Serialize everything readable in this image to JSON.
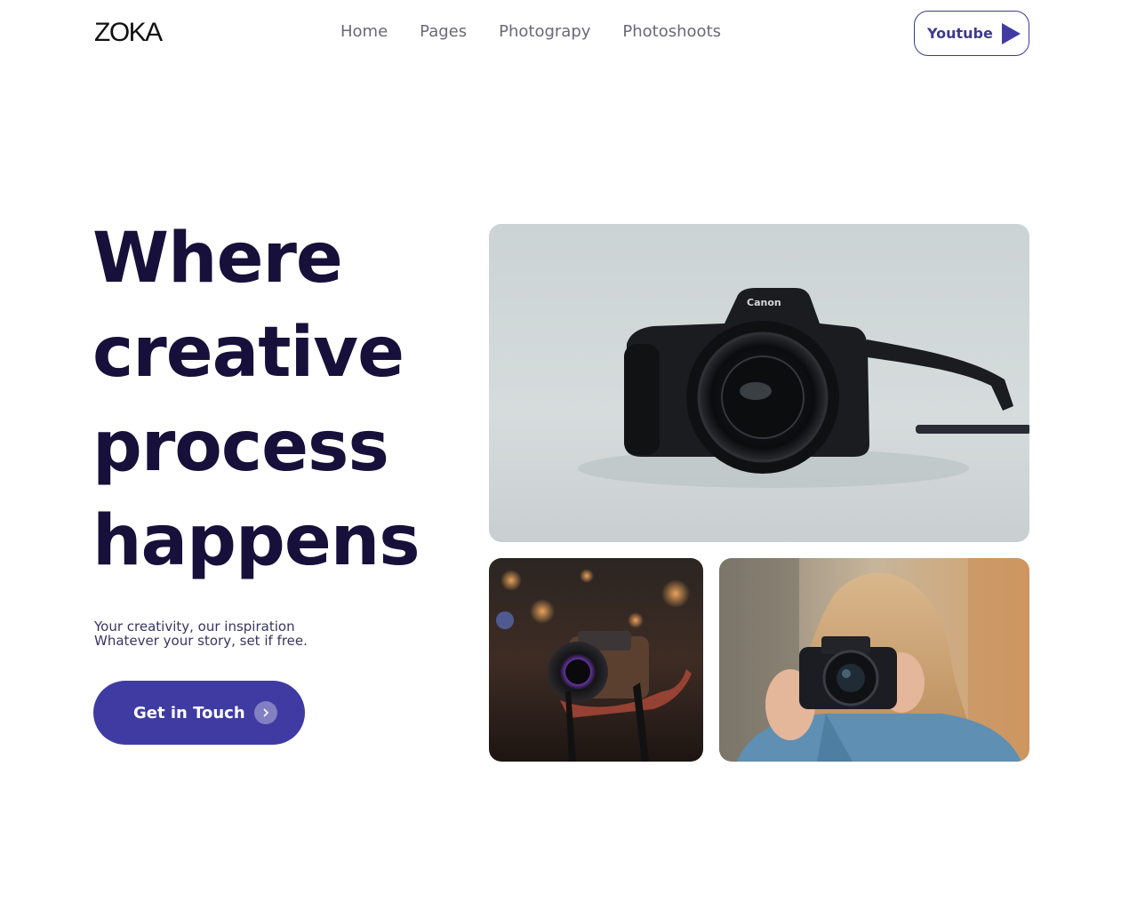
{
  "header": {
    "logo": "ZOKA",
    "nav": [
      "Home",
      "Pages",
      "Photograpy",
      "Photoshoots"
    ],
    "youtube_label": "Youtube"
  },
  "hero": {
    "headline_lines": [
      "Where",
      "creative",
      "process",
      "happens"
    ],
    "subtitle_lines": [
      "Your creativity, our inspiration",
      "Whatever your story, set if free."
    ],
    "cta_label": "Get in Touch"
  },
  "colors": {
    "accent": "#3f3ba3",
    "headline": "#16103a",
    "nav_text": "#6b6878"
  },
  "images": {
    "main": "canon-camera-photo",
    "left": "fujifilm-camera-night-photo",
    "right": "woman-with-camera-photo"
  },
  "icons": {
    "youtube": "play-icon",
    "cta": "chevron-right-icon"
  }
}
